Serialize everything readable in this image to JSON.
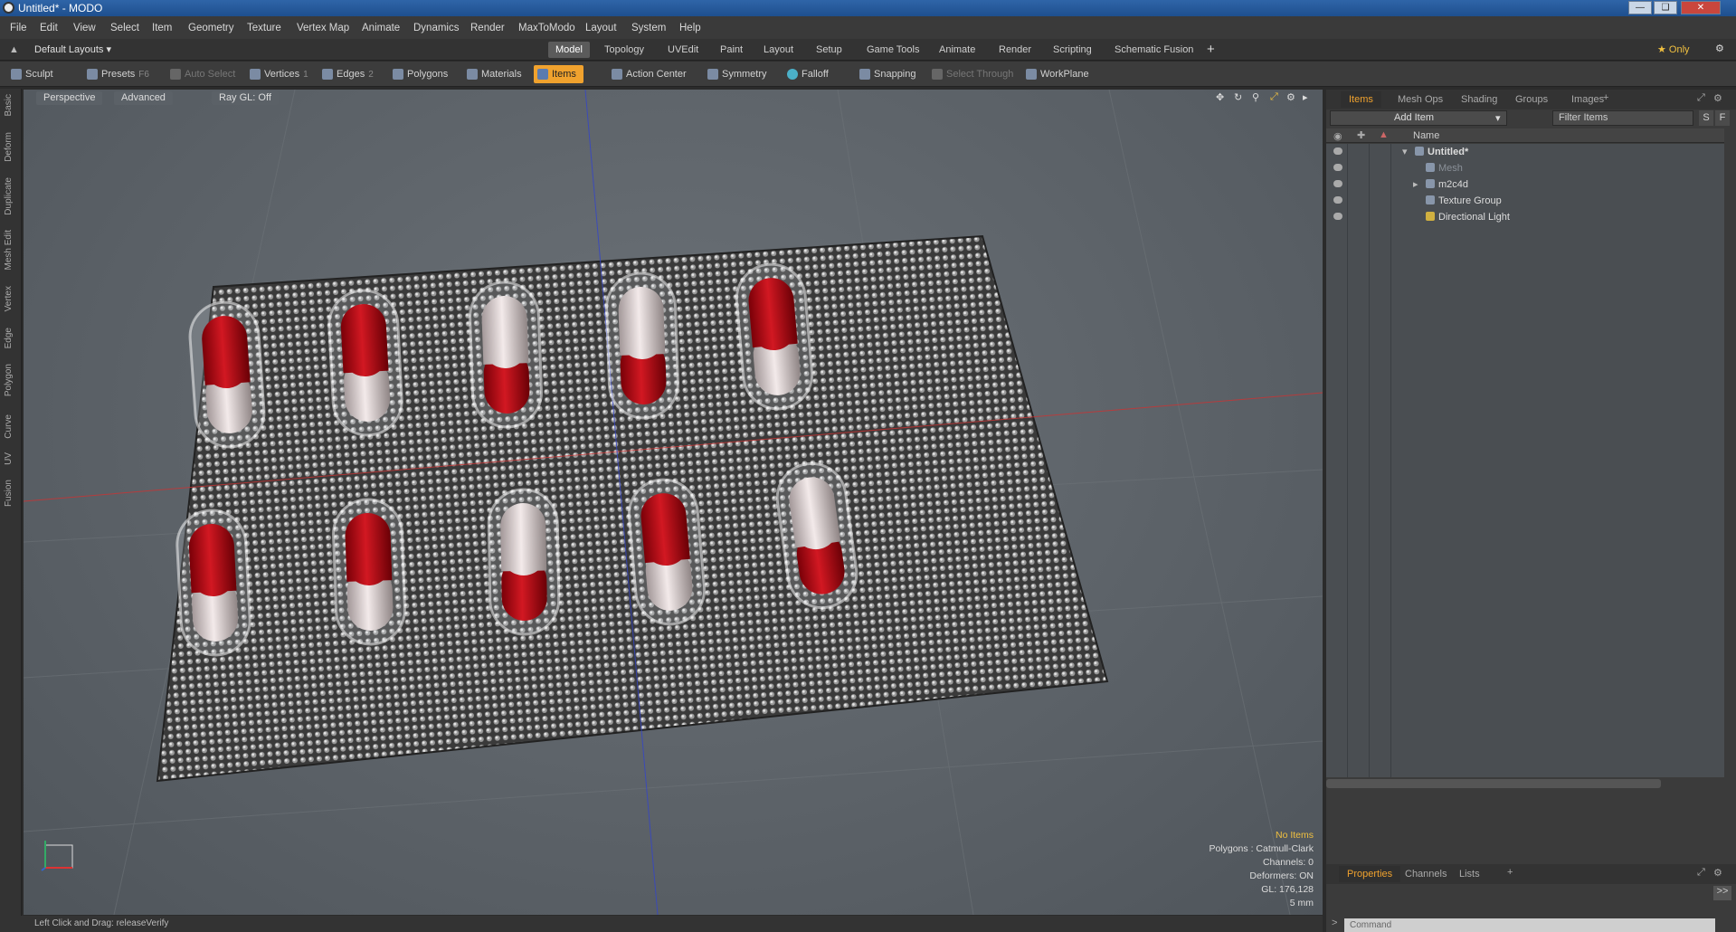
{
  "window": {
    "title": "Untitled* - MODO"
  },
  "menu": [
    "File",
    "Edit",
    "View",
    "Select",
    "Item",
    "Geometry",
    "Texture",
    "Vertex Map",
    "Animate",
    "Dynamics",
    "Render",
    "MaxToModo",
    "Layout",
    "System",
    "Help"
  ],
  "layout_bar": {
    "layout_dropdown": "Default Layouts ▾",
    "tabs": [
      "Model",
      "Topology",
      "UVEdit",
      "Paint",
      "Layout",
      "Setup",
      "Game Tools",
      "Animate",
      "Render",
      "Scripting",
      "Schematic Fusion"
    ],
    "active_tab": "Model",
    "add": "+",
    "only_label": "★ Only"
  },
  "toolbar": {
    "sculpt": "Sculpt",
    "presets": "Presets",
    "presets_key": "F6",
    "auto_select": "Auto Select",
    "vertices": "Vertices",
    "vertices_key": "1",
    "edges": "Edges",
    "edges_key": "2",
    "polygons": "Polygons",
    "materials": "Materials",
    "items": "Items",
    "action_center": "Action Center",
    "symmetry": "Symmetry",
    "falloff": "Falloff",
    "snapping": "Snapping",
    "select_through": "Select Through",
    "workplane": "WorkPlane"
  },
  "left_tabs": [
    "Basic",
    "Deform",
    "Duplicate",
    "Mesh Edit",
    "Vertex",
    "Edge",
    "Polygon",
    "Curve",
    "UV",
    "Fusion"
  ],
  "viewport": {
    "view_mode": "Perspective",
    "shading": "Advanced",
    "raygl": "Ray GL: Off",
    "hud": {
      "selection": "No Items",
      "polygons": "Polygons : Catmull-Clark",
      "channels": "Channels: 0",
      "deformers": "Deformers: ON",
      "gl": "GL: 176,128",
      "scale": "5 mm"
    },
    "colors": {
      "capsule_red": "#b0101a",
      "capsule_white": "#e8dedd",
      "foil": "#2a2a2a"
    }
  },
  "status": {
    "hint": "Left Click and Drag:  releaseVerify"
  },
  "items_panel": {
    "tabs": [
      "Items",
      "Mesh Ops",
      "Shading",
      "Groups",
      "Images"
    ],
    "active_tab": "Items",
    "add_item": "Add Item",
    "filter_placeholder": "Filter Items",
    "s_button": "S",
    "f_button": "F",
    "column_name": "Name",
    "tree": [
      {
        "label": "Untitled*",
        "depth": 0,
        "bold": true
      },
      {
        "label": "Mesh",
        "depth": 1,
        "dim": true
      },
      {
        "label": "m2c4d",
        "depth": 1
      },
      {
        "label": "Texture Group",
        "depth": 1
      },
      {
        "label": "Directional Light",
        "depth": 1
      }
    ]
  },
  "properties_panel": {
    "tabs": [
      "Properties",
      "Channels",
      "Lists"
    ],
    "active_tab": "Properties",
    "command_placeholder": "Command"
  }
}
